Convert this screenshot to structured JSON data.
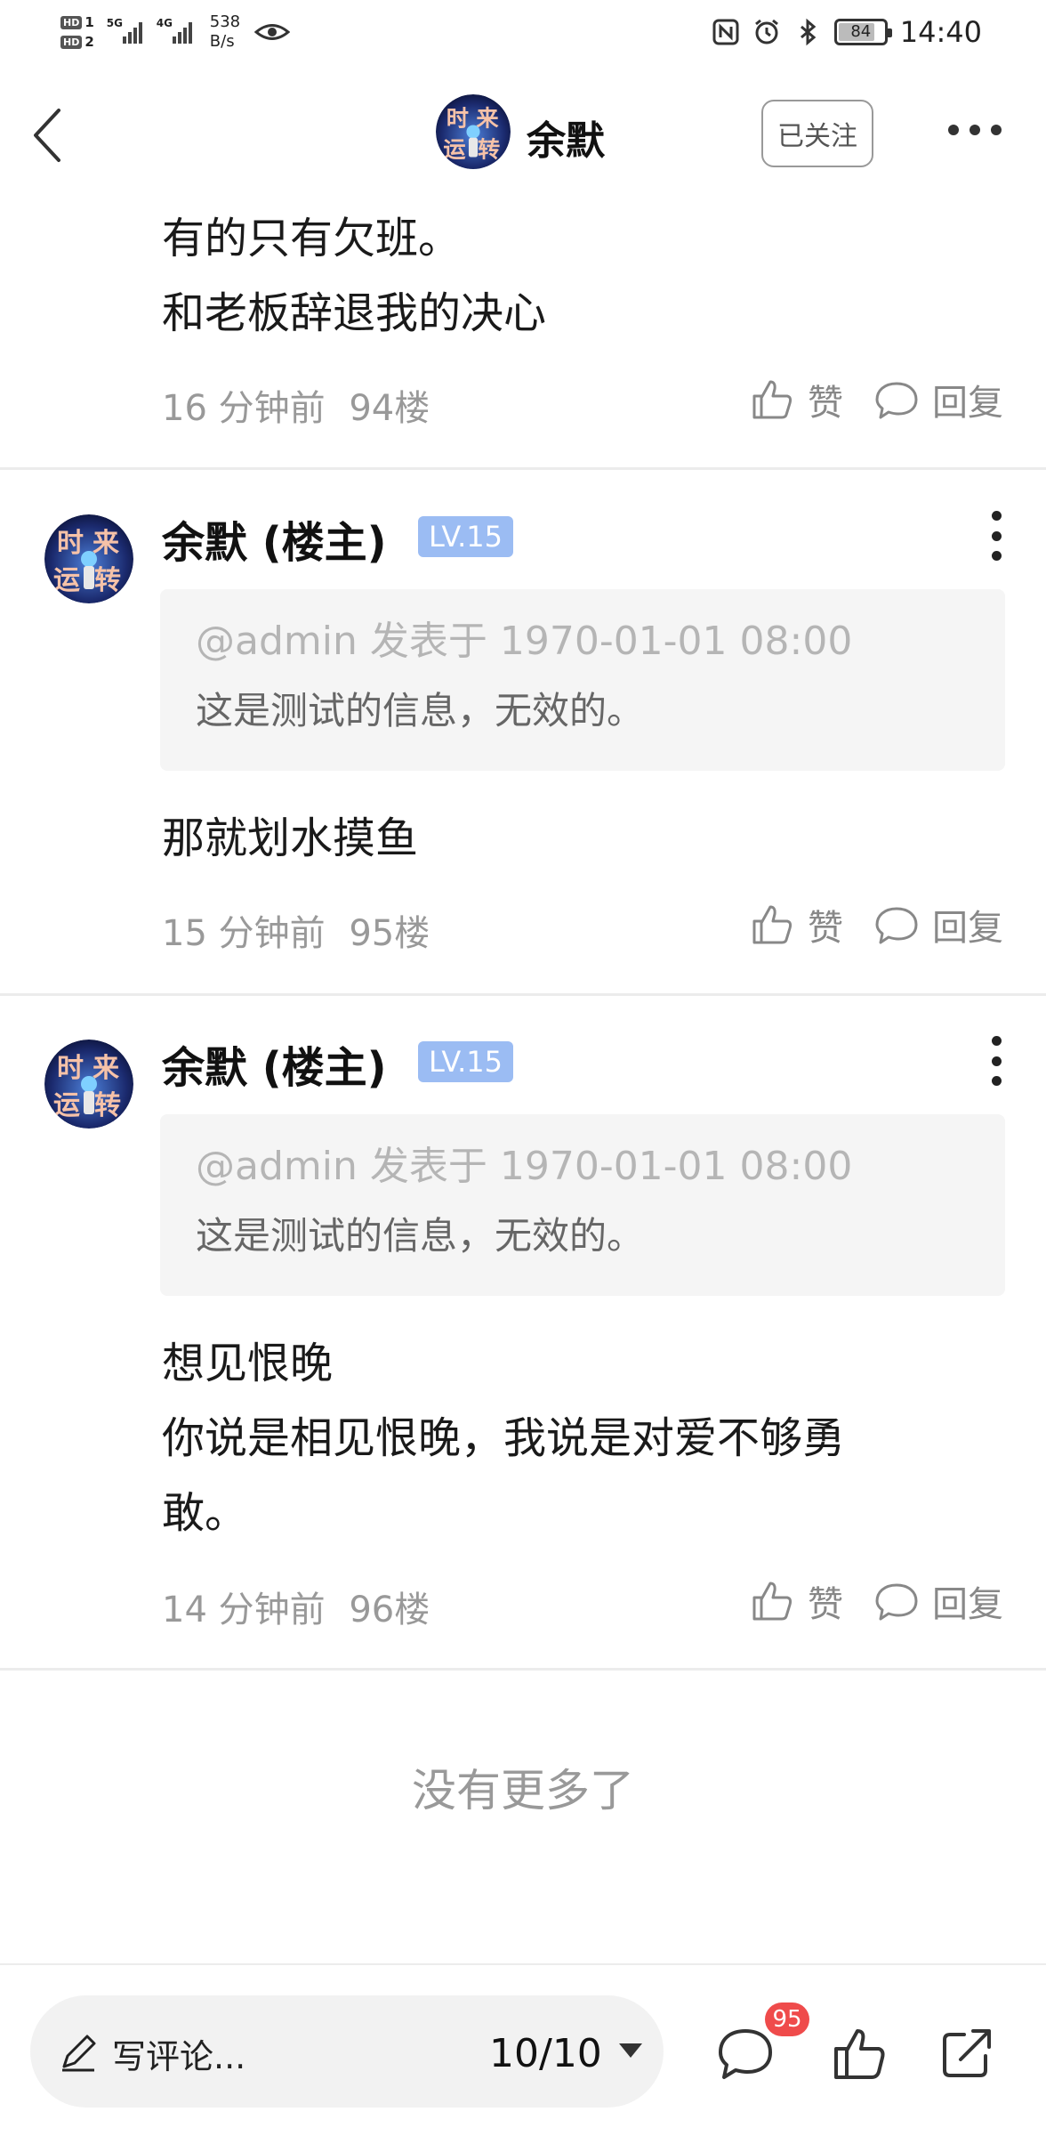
{
  "status_bar": {
    "hd1": "HD",
    "hd1_num": "1",
    "hd2": "HD",
    "hd2_num": "2",
    "net_5g": "5G",
    "net_4g": "4G",
    "speed_value": "538",
    "speed_unit": "B/s",
    "battery": "84",
    "time": "14:40"
  },
  "nav": {
    "title": "余默",
    "follow_label": "已关注"
  },
  "avatar_text": {
    "line1_a": "时",
    "line1_b": "来",
    "line2_a": "运",
    "line2_b": "转"
  },
  "top_comment": {
    "line1": "有的只有欠班。",
    "line2": "和老板辞退我的决心",
    "time": "16 分钟前",
    "floor": "94楼",
    "like_label": "赞",
    "reply_label": "回复"
  },
  "comments": [
    {
      "user": "余默 (楼主)",
      "level": "LV.15",
      "quote_header": "@admin 发表于 1970-01-01 08:00",
      "quote_body": "这是测试的信息，无效的。",
      "lines": [
        "那就划水摸鱼"
      ],
      "time": "15 分钟前",
      "floor": "95楼",
      "like_label": "赞",
      "reply_label": "回复"
    },
    {
      "user": "余默 (楼主)",
      "level": "LV.15",
      "quote_header": "@admin 发表于 1970-01-01 08:00",
      "quote_body": "这是测试的信息，无效的。",
      "lines": [
        "想见恨晚",
        "你说是相见恨晚，我说是对爱不够勇",
        "敢。"
      ],
      "time": "14 分钟前",
      "floor": "96楼",
      "like_label": "赞",
      "reply_label": "回复"
    }
  ],
  "no_more": "没有更多了",
  "bottom_bar": {
    "input_placeholder": "写评论...",
    "page_indicator": "10/10",
    "comment_badge": "95"
  },
  "colors": {
    "level_badge": "#9bbcf3",
    "badge_red": "#ef4b4b",
    "meta_gray": "#999999",
    "quote_bg": "#f5f5f5"
  },
  "icons": [
    "back-arrow-icon",
    "more-horizontal-icon",
    "more-vertical-icon",
    "thumbs-up-icon",
    "comment-bubble-icon",
    "pencil-icon",
    "caret-down-icon",
    "share-icon",
    "eye-icon",
    "nfc-icon",
    "alarm-icon",
    "bluetooth-icon",
    "battery-icon"
  ]
}
